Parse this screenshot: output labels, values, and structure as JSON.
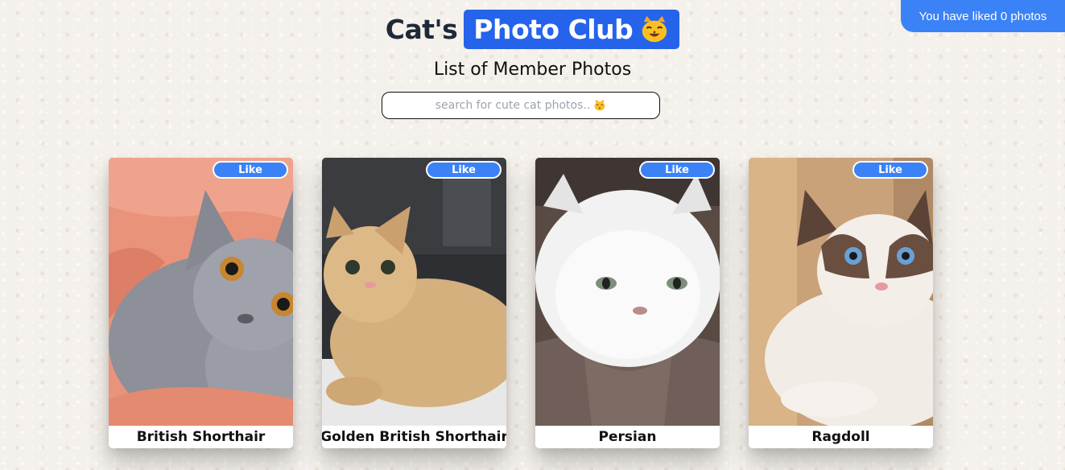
{
  "status": {
    "liked_text": "You have liked 0 photos"
  },
  "header": {
    "title_main": "Cat's",
    "title_highlight": "Photo Club",
    "subtitle": "List of Member Photos"
  },
  "search": {
    "placeholder": "search for cute cat photos.."
  },
  "cards": [
    {
      "name": "British Shorthair",
      "like_label": "Like"
    },
    {
      "name": "Golden British Shorthair",
      "like_label": "Like"
    },
    {
      "name": "Persian",
      "like_label": "Like"
    },
    {
      "name": "Ragdoll",
      "like_label": "Like"
    }
  ],
  "colors": {
    "accent": "#3b82f6",
    "title_pill": "#2563eb",
    "background": "#f4f0eb"
  },
  "icons": {
    "title_emoji": "smiling-cat-icon",
    "search_emoji": "kissing-cat-icon"
  }
}
